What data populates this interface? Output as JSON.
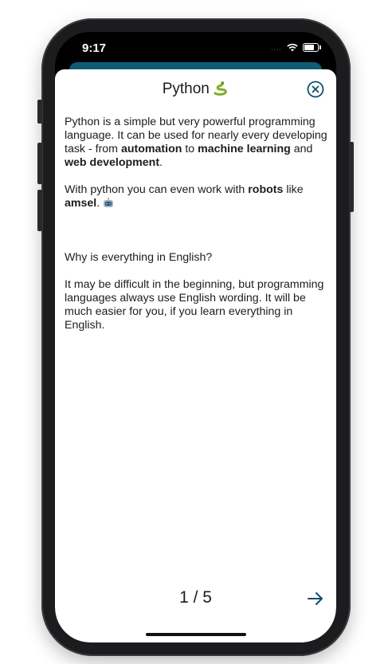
{
  "status": {
    "time": "9:17"
  },
  "sheet": {
    "title": "Python",
    "title_icon": "snake-icon",
    "close_icon": "close-circle-icon"
  },
  "content": {
    "p1_part1": "Python is a simple but very powerful programming language. It can be used for nearly every developing task - from ",
    "p1_bold1": "automation",
    "p1_part2": " to ",
    "p1_bold2": "machine learning",
    "p1_part3": " and ",
    "p1_bold3": "web development",
    "p1_part4": ".",
    "p2_part1": "With python you can even work with ",
    "p2_bold1": "robots",
    "p2_part2": " like ",
    "p2_bold2": "amsel",
    "p2_part3": ". ",
    "p2_icon": "robot-icon",
    "p3": "Why is everything in English?",
    "p4": "It may be difficult in the beginning, but programming languages always use English wording. It will be much easier for you, if you learn everything in English."
  },
  "pager": {
    "label": "1 / 5",
    "next_icon": "arrow-right-icon"
  },
  "colors": {
    "accent": "#0e4d6e",
    "teal_background": "#0e5b73",
    "text": "#1c1c1e"
  }
}
